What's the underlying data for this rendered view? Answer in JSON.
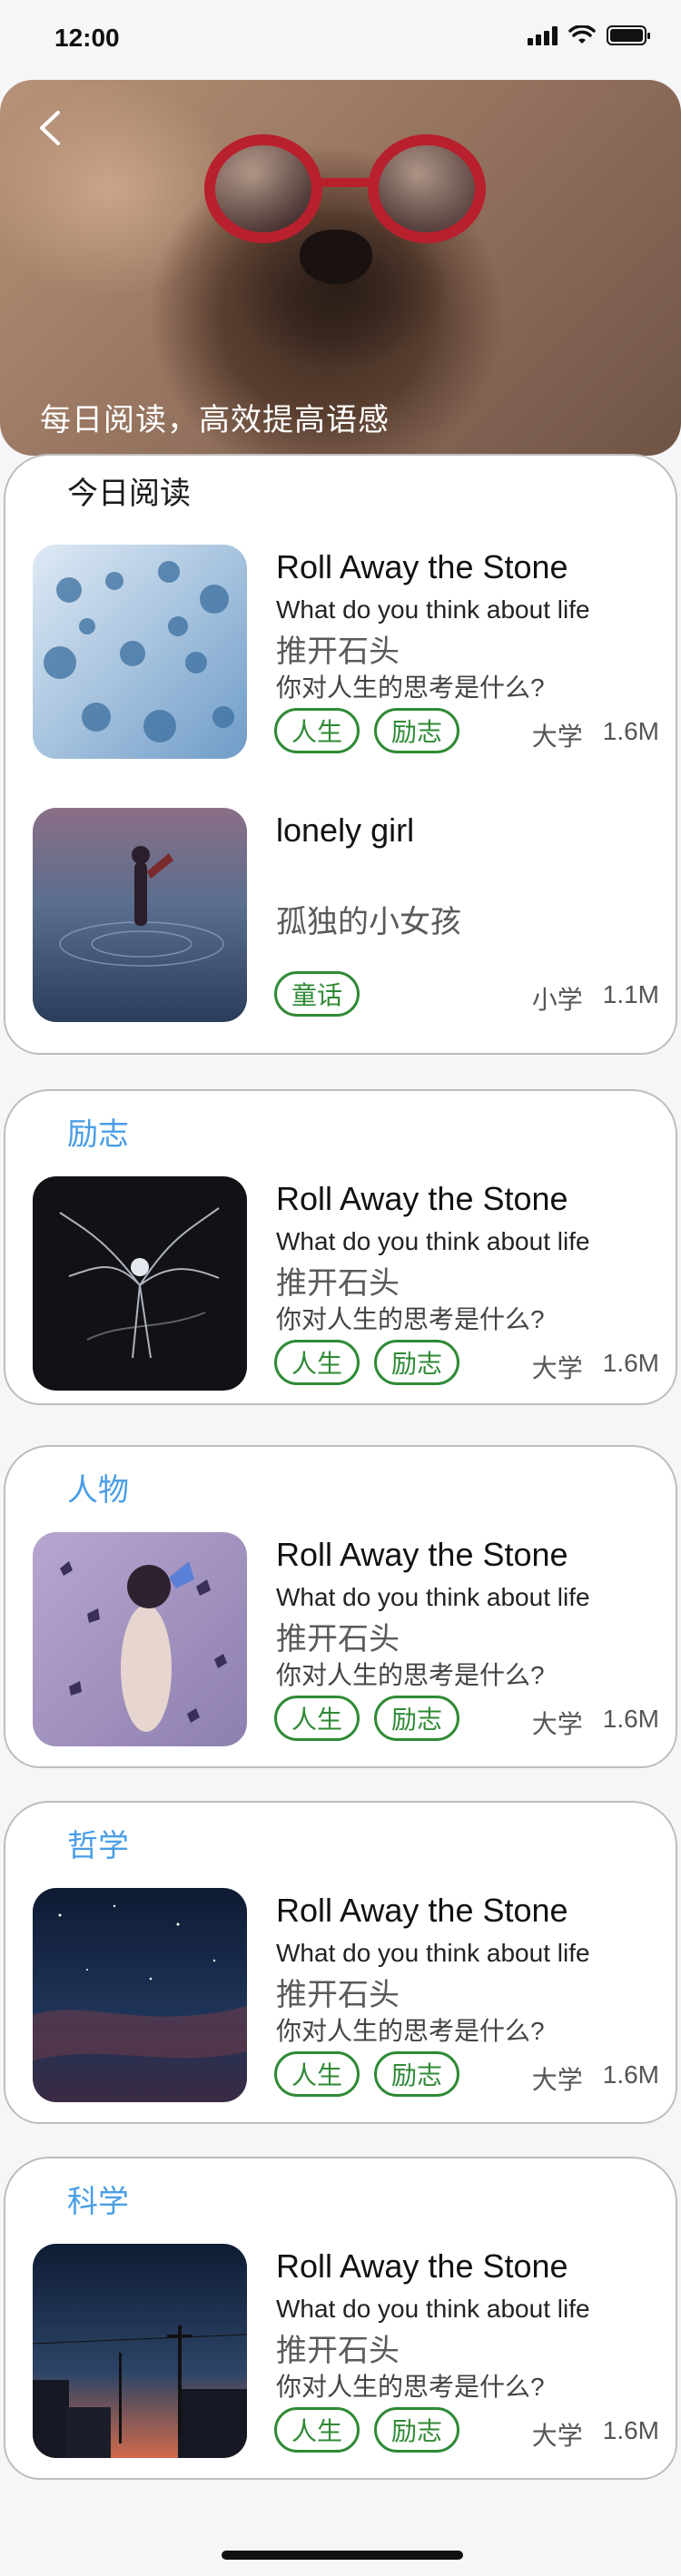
{
  "status_bar": {
    "time": "12:00"
  },
  "hero": {
    "caption": "每日阅读，高效提高语感"
  },
  "sections": [
    {
      "title": "今日阅读",
      "books": [
        {
          "title_en": "Roll Away the Stone",
          "subtitle_en": "What do you think about life",
          "title_cn": "推开石头",
          "question_cn": "你对人生的思考是什么?",
          "tags": [
            "人生",
            "励志"
          ],
          "level": "大学",
          "size": "1.6M",
          "cover_icon": "snowy-forest-image"
        },
        {
          "title_en": "lonely girl",
          "subtitle_en": "",
          "title_cn": "孤独的小女孩",
          "question_cn": "",
          "tags": [
            "童话"
          ],
          "level": "小学",
          "size": "1.1M",
          "cover_icon": "girl-on-water-image"
        }
      ]
    },
    {
      "title": "励志",
      "books": [
        {
          "title_en": "Roll Away the Stone",
          "subtitle_en": "What do you think about life",
          "title_cn": "推开石头",
          "question_cn": "你对人生的思考是什么?",
          "tags": [
            "人生",
            "励志"
          ],
          "level": "大学",
          "size": "1.6M",
          "cover_icon": "winged-figure-image"
        }
      ]
    },
    {
      "title": "人物",
      "books": [
        {
          "title_en": "Roll Away the Stone",
          "subtitle_en": "What do you think about life",
          "title_cn": "推开石头",
          "question_cn": "你对人生的思考是什么?",
          "tags": [
            "人生",
            "励志"
          ],
          "level": "大学",
          "size": "1.6M",
          "cover_icon": "butterflies-woman-image"
        }
      ]
    },
    {
      "title": "哲学",
      "books": [
        {
          "title_en": "Roll Away the Stone",
          "subtitle_en": "What do you think about life",
          "title_cn": "推开石头",
          "question_cn": "你对人生的思考是什么?",
          "tags": [
            "人生",
            "励志"
          ],
          "level": "大学",
          "size": "1.6M",
          "cover_icon": "night-sky-image"
        }
      ]
    },
    {
      "title": "科学",
      "books": [
        {
          "title_en": "Roll Away the Stone",
          "subtitle_en": "What do you think about life",
          "title_cn": "推开石头",
          "question_cn": "你对人生的思考是什么?",
          "tags": [
            "人生",
            "励志"
          ],
          "level": "大学",
          "size": "1.6M",
          "cover_icon": "dusk-street-image"
        }
      ]
    }
  ],
  "colors": {
    "tag_green": "#2f8a35",
    "section_title_blue": "#4a9ee6"
  }
}
